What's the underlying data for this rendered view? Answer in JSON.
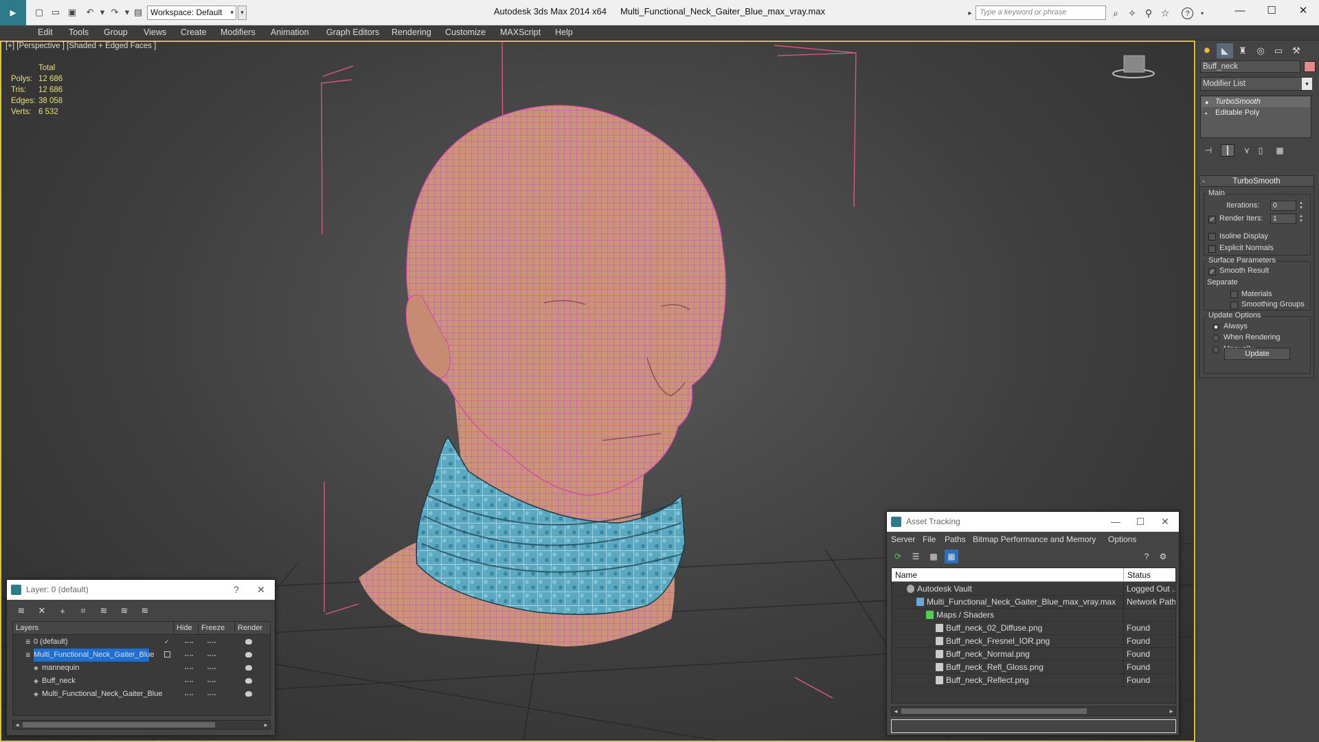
{
  "titlebar": {
    "workspace": "Workspace: Default",
    "app_name": "Autodesk 3ds Max  2014 x64",
    "file_name": "Multi_Functional_Neck_Gaiter_Blue_max_vray.max",
    "search_placeholder": "Type a keyword or phrase"
  },
  "menu": [
    "Edit",
    "Tools",
    "Group",
    "Views",
    "Create",
    "Modifiers",
    "Animation",
    "Graph Editors",
    "Rendering",
    "Customize",
    "MAXScript",
    "Help"
  ],
  "viewport": {
    "label": "[+] [Perspective ] [Shaded + Edged Faces ]",
    "stats": {
      "header": "Total",
      "rows": [
        {
          "k": "Polys:",
          "v": "12 686"
        },
        {
          "k": "Tris:",
          "v": "12 686"
        },
        {
          "k": "Edges:",
          "v": "38 058"
        },
        {
          "k": "Verts:",
          "v": "6 532"
        }
      ]
    }
  },
  "cmdpanel": {
    "object_name": "Buff_neck",
    "object_color": "#e88a8a",
    "modifier_list": "Modifier List",
    "stack": [
      "TurboSmooth",
      "Editable Poly"
    ],
    "rollout_title": "TurboSmooth",
    "main_label": "Main",
    "iterations_label": "Iterations:",
    "iterations_value": "0",
    "render_iters_label": "Render Iters:",
    "render_iters_value": "1",
    "isoline_label": "Isoline Display",
    "explicit_label": "Explicit Normals",
    "surface_label": "Surface Parameters",
    "smooth_label": "Smooth Result",
    "separate_label": "Separate",
    "materials_label": "Materials",
    "smoothing_groups_label": "Smoothing Groups",
    "update_options_label": "Update Options",
    "always_label": "Always",
    "when_rendering_label": "When Rendering",
    "manually_label": "Manually",
    "update_button": "Update"
  },
  "layer_window": {
    "title": "Layer: 0 (default)",
    "help": "?",
    "columns": [
      "Layers",
      "Hide",
      "Freeze",
      "Render"
    ],
    "rows": [
      {
        "name": "0 (default)",
        "indent": 0,
        "selected": false
      },
      {
        "name": "Multi_Functional_Neck_Gaiter_Blue",
        "indent": 0,
        "selected": true
      },
      {
        "name": "mannequin",
        "indent": 1,
        "selected": false
      },
      {
        "name": "Buff_neck",
        "indent": 1,
        "selected": false
      },
      {
        "name": "Multi_Functional_Neck_Gaiter_Blue",
        "indent": 1,
        "selected": false
      }
    ]
  },
  "asset_window": {
    "title": "Asset Tracking",
    "menu": [
      "Server",
      "File",
      "Paths",
      "Bitmap Performance and Memory",
      "Options"
    ],
    "columns": [
      "Name",
      "Status"
    ],
    "rows": [
      {
        "name": "Autodesk Vault",
        "status": "Logged Out ...",
        "indent": 1
      },
      {
        "name": "Multi_Functional_Neck_Gaiter_Blue_max_vray.max",
        "status": "Network Path",
        "indent": 2
      },
      {
        "name": "Maps / Shaders",
        "status": "",
        "indent": 3
      },
      {
        "name": "Buff_neck_02_Diffuse.png",
        "status": "Found",
        "indent": 4
      },
      {
        "name": "Buff_neck_Fresnel_IOR.png",
        "status": "Found",
        "indent": 4
      },
      {
        "name": "Buff_neck_Normal.png",
        "status": "Found",
        "indent": 4
      },
      {
        "name": "Buff_neck_Refl_Gloss.png",
        "status": "Found",
        "indent": 4
      },
      {
        "name": "Buff_neck_Reflect.png",
        "status": "Found",
        "indent": 4
      }
    ]
  },
  "colors": {
    "viewport_border": "#d7c25a",
    "stats_text": "#e9e07a",
    "wire": "#d63fb4",
    "skin": "#c9957a",
    "gaiter": "#5aa9c0",
    "selection": "#1e6fd0"
  }
}
